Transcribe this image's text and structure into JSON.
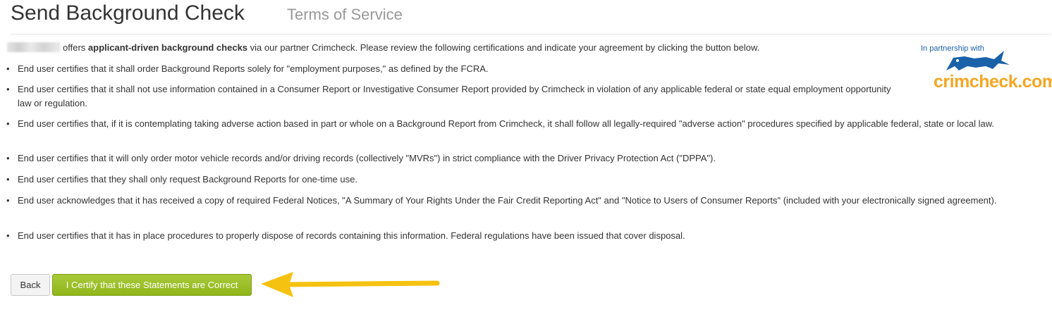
{
  "header": {
    "title": "Send Background Check",
    "subtitle": "Terms of Service"
  },
  "intro": {
    "text_before_bold": "offers",
    "bold_text": "applicant-driven background checks",
    "text_after_bold": "via our partner Crimcheck. Please review the following certifications and indicate your agreement by clicking the button below."
  },
  "certifications": [
    "End user certifies that it shall order Background Reports solely for \"employment purposes,\" as defined by the FCRA.",
    "End user certifies that it shall not use information contained in a Consumer Report or Investigative Consumer Report provided by Crimcheck in violation of any applicable federal or state equal employment opportunity law or regulation.",
    "End user certifies that, if it is contemplating taking adverse action based in part or whole on a Background Report from Crimcheck, it shall follow all legally-required \"adverse action\" procedures specified by applicable federal, state or local law.",
    "End user certifies that it will only order motor vehicle records and/or driving records (collectively \"MVRs\") in strict compliance with the Driver Privacy Protection Act (\"DPPA\").",
    "End user certifies that they shall only request Background Reports for one-time use.",
    "End user acknowledges that it has received a copy of required Federal Notices, \"A Summary of Your Rights Under the Fair Credit Reporting Act\" and \"Notice to Users of Consumer Reports\" (included with your electronically signed agreement).",
    "End user certifies that it has in place procedures to properly dispose of records containing this information. Federal regulations have been issued that cover disposal."
  ],
  "partner": {
    "caption": "In partnership with",
    "brand": "crimcheck.com"
  },
  "buttons": {
    "back": "Back",
    "certify": "I Certify that these Statements are Correct"
  },
  "colors": {
    "accent_green": "#8fb61a",
    "arrow": "#f5c211",
    "brand_orange": "#f5a623",
    "brand_blue": "#1a62a8"
  },
  "icons": {
    "annotation": "arrow-left-icon",
    "logo_mascot": "crimcheck-mascot-icon"
  }
}
